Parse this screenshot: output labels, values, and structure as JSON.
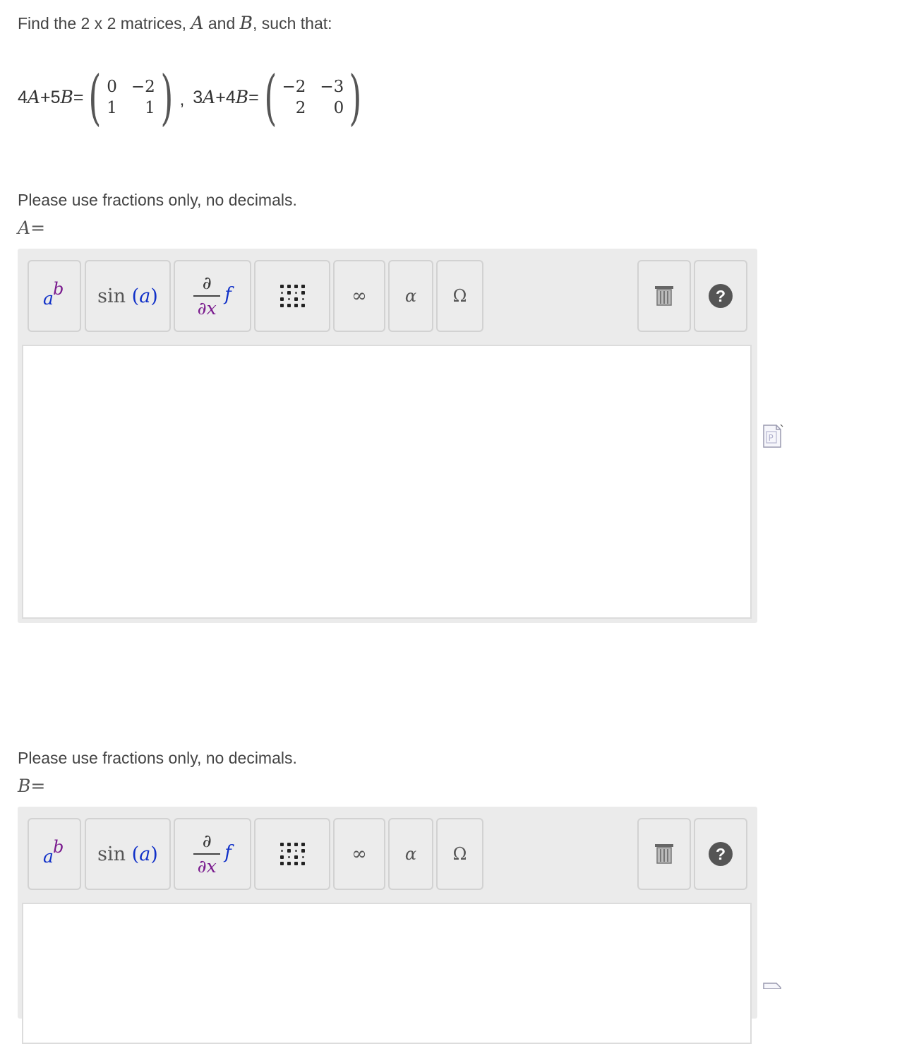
{
  "question": {
    "prefix": "Find the 2 x 2 matrices, ",
    "var_a": "A",
    "middle": " and ",
    "var_b": "B",
    "suffix": ", such that:"
  },
  "equations": [
    {
      "lhs_c1": "4",
      "lhs_v1": "A",
      "lhs_plus": "+",
      "lhs_c2": "5",
      "lhs_v2": "B",
      "lhs_eq": "=",
      "matrix": [
        "0",
        "−2",
        "1",
        "1"
      ],
      "separator": ","
    },
    {
      "lhs_c1": "3",
      "lhs_v1": "A",
      "lhs_plus": "+",
      "lhs_c2": "4",
      "lhs_v2": "B",
      "lhs_eq": "=",
      "matrix": [
        "−2",
        "−3",
        "2",
        "0"
      ]
    }
  ],
  "answers": [
    {
      "note": "Please use fractions only, no decimals.",
      "var": "A",
      "eq": "=",
      "value": ""
    },
    {
      "note": "Please use fractions only, no decimals.",
      "var": "B",
      "eq": "=",
      "value": ""
    }
  ],
  "toolbar": {
    "power": {
      "base": "a",
      "exp": "b",
      "icon": "power-icon"
    },
    "function": {
      "name": "sin",
      "lparen": "(",
      "arg": "a",
      "rparen": ")",
      "icon": "function-icon"
    },
    "calculus": {
      "num": "∂",
      "den": "∂x",
      "f": "f",
      "icon": "derivative-icon"
    },
    "matrix_icon": "matrix-icon",
    "infinity": "∞",
    "alpha": "α",
    "omega": "Ω",
    "trash_icon": "trash-icon",
    "help": "?"
  },
  "colors": {
    "variable_blue": "#1030c8",
    "exponent_purple": "#7a1b8e",
    "toolbar_bg": "#ebebeb",
    "button_bg": "#ececec"
  }
}
